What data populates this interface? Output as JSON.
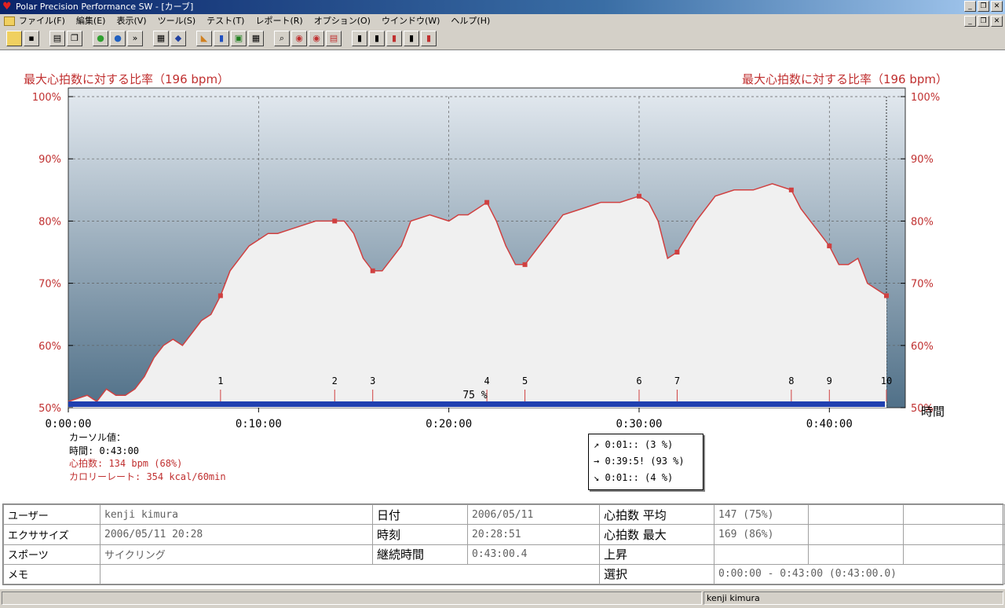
{
  "window": {
    "title": "Polar Precision Performance SW - [カーブ]"
  },
  "menu": [
    "ファイル(F)",
    "編集(E)",
    "表示(V)",
    "ツール(S)",
    "テスト(T)",
    "レポート(R)",
    "オプション(O)",
    "ウインドウ(W)",
    "ヘルプ(H)"
  ],
  "chart": {
    "left_axis_title": "最大心拍数に対する比率（196 bpm）",
    "right_axis_title": "最大心拍数に対する比率（196 bpm）",
    "x_axis_title": "時間",
    "avg_label": "75 %",
    "colors": {
      "line": "#d04040",
      "fill": "#f0f0f0",
      "bar": "#2040b0",
      "bg_top": "#e4eaf0",
      "bg_bottom": "#507088",
      "text": "#c03030"
    }
  },
  "chart_data": {
    "type": "area",
    "title": "",
    "xlabel": "時間",
    "ylabel": "最大心拍数に対する比率（196 bpm）",
    "xlim": [
      0,
      43
    ],
    "ylim": [
      50,
      100
    ],
    "x_tick_labels": [
      "0:00:00",
      "0:10:00",
      "0:20:00",
      "0:30:00",
      "0:40:00"
    ],
    "y_tick_labels": [
      "50%",
      "60%",
      "70%",
      "80%",
      "90%",
      "100%"
    ],
    "grid": true,
    "series": [
      {
        "x": [
          0,
          1,
          1.5,
          2,
          2.5,
          3,
          3.5,
          4,
          4.5,
          5,
          5.5,
          6,
          6.5,
          7,
          7.5,
          8,
          8.5,
          9,
          9.5,
          10,
          10.5,
          11,
          12,
          13,
          14,
          14.5,
          15,
          15.5,
          16,
          16.5,
          17,
          17.5,
          18,
          19,
          20,
          20.5,
          21,
          21.5,
          22,
          22.5,
          23,
          23.5,
          24,
          24.5,
          25,
          26,
          27,
          28,
          29,
          30,
          30.5,
          31,
          31.5,
          32,
          33,
          34,
          35,
          36,
          37,
          38,
          38.5,
          39,
          39.5,
          40,
          40.5,
          41,
          41.5,
          42,
          42.5,
          43
        ],
        "y": [
          51,
          52,
          51,
          53,
          52,
          52,
          53,
          55,
          58,
          60,
          61,
          60,
          62,
          64,
          65,
          68,
          72,
          74,
          76,
          77,
          78,
          78,
          79,
          80,
          80,
          80,
          78,
          74,
          72,
          72,
          74,
          76,
          80,
          81,
          80,
          81,
          81,
          82,
          83,
          80,
          76,
          73,
          73,
          75,
          77,
          81,
          82,
          83,
          83,
          84,
          83,
          80,
          74,
          75,
          80,
          84,
          85,
          85,
          86,
          85,
          82,
          80,
          78,
          76,
          73,
          73,
          74,
          70,
          69,
          68
        ]
      }
    ],
    "laps": [
      "1",
      "2",
      "3",
      "4",
      "5",
      "6",
      "7",
      "8",
      "9",
      "10"
    ],
    "lap_times": [
      8,
      14,
      16,
      22,
      24,
      30,
      32,
      38,
      40,
      43
    ]
  },
  "cursor": {
    "header": "カーソル値：",
    "time": "時間: 0:43:00",
    "hr": "心拍数: 134 bpm (68%)",
    "calorie": "カロリーレート: 354 kcal/60min"
  },
  "zones": {
    "above": "0:01:: (3 %)",
    "within": "0:39:5! (93 %)",
    "below": "0:01:: (4 %)"
  },
  "table": {
    "user_label": "ユーザー",
    "user_value": "kenji kimura",
    "date_label": "日付",
    "date_value": "2006/05/11",
    "hr_avg_label": "心拍数 平均",
    "hr_avg_value": "147 (75%)",
    "exercise_label": "エクササイズ",
    "exercise_value": "2006/05/11 20:28",
    "time_label": "時刻",
    "time_value": "20:28:51",
    "hr_max_label": "心拍数 最大",
    "hr_max_value": "169 (86%)",
    "sport_label": "スポーツ",
    "sport_value": "サイクリング",
    "duration_label": "継続時間",
    "duration_value": "0:43:00.4",
    "ascent_label": "上昇",
    "memo_label": "メモ",
    "selection_label": "選択",
    "selection_value": "0:00:00 - 0:43:00 (0:43:00.0)"
  },
  "status": {
    "user": "kenji kimura"
  }
}
